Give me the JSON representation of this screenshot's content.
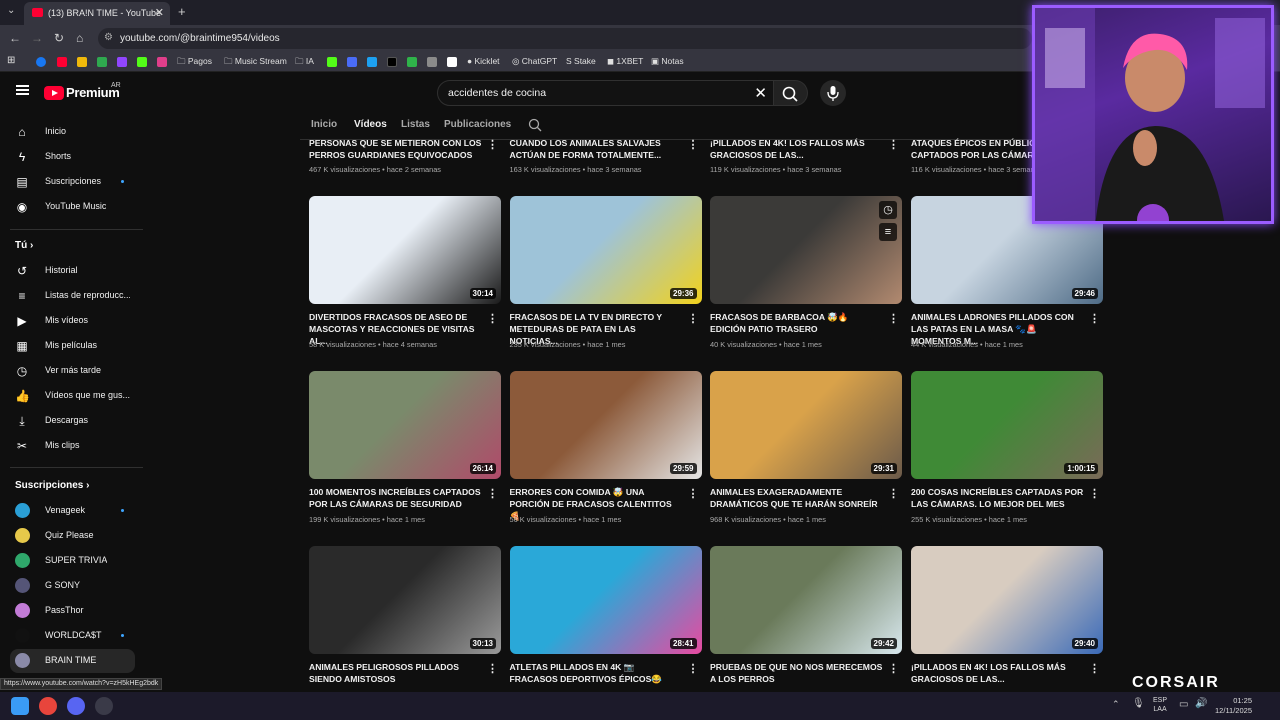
{
  "browser": {
    "tab_title": "(13) BRA!N TIME - YouTube",
    "url": "youtube.com/@braintime954/videos",
    "bookmarks": [
      "Pagos",
      "Music Stream",
      "IA",
      "Kicklet",
      "ChatGPT",
      "Stake",
      "1XBET",
      "Notas"
    ],
    "status_url": "https://www.youtube.com/watch?v=zH5kHEg2bdk"
  },
  "youtube": {
    "logo_text": "Premium",
    "logo_country": "AR",
    "search_query": "accidentes de cocina",
    "channel_tabs": [
      "Inicio",
      "Videos",
      "Listas",
      "Publicaciones"
    ],
    "channel_tabs_display": [
      "Inicio",
      "Vídeos",
      "Listas",
      "Publicaciones"
    ],
    "active_tab": "Vídeos"
  },
  "sidebar": {
    "main": [
      {
        "label": "Inicio",
        "icon": "home-icon"
      },
      {
        "label": "Shorts",
        "icon": "shorts-icon"
      },
      {
        "label": "Suscripciones",
        "icon": "subscriptions-icon",
        "dot": true
      },
      {
        "label": "YouTube Music",
        "icon": "music-icon"
      }
    ],
    "you_heading": "Tú",
    "you": [
      {
        "label": "Historial",
        "icon": "history-icon"
      },
      {
        "label": "Listas de reproducc...",
        "icon": "playlists-icon"
      },
      {
        "label": "Mis vídeos",
        "icon": "my-videos-icon"
      },
      {
        "label": "Mis películas",
        "icon": "movies-icon"
      },
      {
        "label": "Ver más tarde",
        "icon": "watch-later-icon"
      },
      {
        "label": "Vídeos que me gus...",
        "icon": "like-icon"
      },
      {
        "label": "Descargas",
        "icon": "download-icon"
      },
      {
        "label": "Mis clips",
        "icon": "clips-icon"
      }
    ],
    "subs_heading": "Suscripciones",
    "subs": [
      {
        "label": "Venageek",
        "color": "#2a9fd6",
        "dot": true
      },
      {
        "label": "Quiz Please",
        "color": "#e6c84a",
        "dot": false
      },
      {
        "label": "SUPER TRIVIA",
        "color": "#2fa86b",
        "dot": false
      },
      {
        "label": "G SONY",
        "color": "#555577",
        "dot": false
      },
      {
        "label": "PassThor",
        "color": "#c27bd6",
        "dot": false
      },
      {
        "label": "WORLDCA$T",
        "color": "#111111",
        "dot": true
      },
      {
        "label": "BRAIN TIME",
        "color": "#8a8aa8",
        "dot": false
      }
    ]
  },
  "top_row": [
    {
      "title": "PERSONAS QUE SE METIERON CON LOS PERROS GUARDIANES EQUIVOCADOS",
      "meta": "467 K visualizaciones • hace 2 semanas"
    },
    {
      "title": "CUANDO LOS ANIMALES SALVAJES ACTÚAN DE FORMA TOTALMENTE...",
      "meta": "163 K visualizaciones • hace 3 semanas"
    },
    {
      "title": "¡PILLADOS EN 4K! LOS FALLOS MÁS GRACIOSOS DE LAS...",
      "meta": "119 K visualizaciones • hace 3 semanas"
    },
    {
      "title": "ATAQUES ÉPICOS EN PÚBLICO CAPTADOS POR LAS CÁMARAS",
      "meta": "116 K visualizaciones • hace 3 semanas"
    }
  ],
  "videos": [
    {
      "title": "DIVERTIDOS FRACASOS DE ASEO DE MASCOTAS Y REACCIONES DE VISITAS AL...",
      "meta": "58 K visualizaciones • hace 4 semanas",
      "duration": "30:14",
      "colors": [
        "#e8eef5",
        "#1a1a1a"
      ]
    },
    {
      "title": "FRACASOS DE LA TV EN DIRECTO Y METEDURAS DE PATA EN LAS NOTICIAS...",
      "meta": "235 K visualizaciones • hace 1 mes",
      "duration": "29:36",
      "colors": [
        "#9ec3d8",
        "#f2d21c"
      ]
    },
    {
      "title": "FRACASOS DE BARBACOA 🤯🔥 EDICIÓN PATIO TRASERO",
      "meta": "40 K visualizaciones • hace 1 mes",
      "duration": "",
      "colors": [
        "#3b3a38",
        "#b28a70"
      ]
    },
    {
      "title": "ANIMALES LADRONES PILLADOS CON LAS PATAS EN LA MASA 🐾🚨 MOMENTOS M...",
      "meta": "44 K visualizaciones • hace 1 mes",
      "duration": "29:46",
      "colors": [
        "#c7d4e0",
        "#4e6b86"
      ]
    },
    {
      "title": "100 MOMENTOS INCREÍBLES CAPTADOS POR LAS CÁMARAS DE SEGURIDAD",
      "meta": "199 K visualizaciones • hace 1 mes",
      "duration": "26:14",
      "colors": [
        "#7a8a6b",
        "#b04a6a"
      ]
    },
    {
      "title": "ERRORES CON COMIDA 🤯 UNA PORCIÓN DE FRACASOS CALENTITOS 🍕",
      "meta": "56 K visualizaciones • hace 1 mes",
      "duration": "29:59",
      "colors": [
        "#8c5a3a",
        "#e5e5e5"
      ]
    },
    {
      "title": "ANIMALES EXAGERADAMENTE DRAMÁTICOS QUE TE HARÁN SONREÍR",
      "meta": "968 K visualizaciones • hace 1 mes",
      "duration": "29:31",
      "colors": [
        "#d9a24a",
        "#6b5a4a"
      ]
    },
    {
      "title": "200 COSAS INCREÍBLES CAPTADAS POR LAS CÁMARAS. LO MEJOR DEL MES",
      "meta": "255 K visualizaciones • hace 1 mes",
      "duration": "1:00:15",
      "colors": [
        "#3f8a36",
        "#7a6a58"
      ]
    },
    {
      "title": "ANIMALES PELIGROSOS PILLADOS SIENDO AMISTOSOS",
      "meta": "",
      "duration": "30:13",
      "colors": [
        "#2a2a2a",
        "#9a9a9a"
      ]
    },
    {
      "title": "ATLETAS PILLADOS EN 4K 📷 FRACASOS DEPORTIVOS ÉPICOS😂",
      "meta": "",
      "duration": "28:41",
      "colors": [
        "#2aa8d8",
        "#e84aa0"
      ]
    },
    {
      "title": "PRUEBAS DE QUE NO NOS MERECEMOS A LOS PERROS",
      "meta": "",
      "duration": "29:42",
      "colors": [
        "#6a7a5a",
        "#d8e8ee"
      ]
    },
    {
      "title": "¡PILLADOS EN 4K! LOS FALLOS MÁS GRACIOSOS DE LAS...",
      "meta": "",
      "duration": "29:40",
      "colors": [
        "#d8ccc0",
        "#3a6ab8"
      ]
    }
  ],
  "taskbar": {
    "lang": [
      "ESP",
      "LAA"
    ],
    "time": "01:25",
    "date": "12/11/2025"
  },
  "overlay": {
    "brand": "CORSAIR"
  }
}
